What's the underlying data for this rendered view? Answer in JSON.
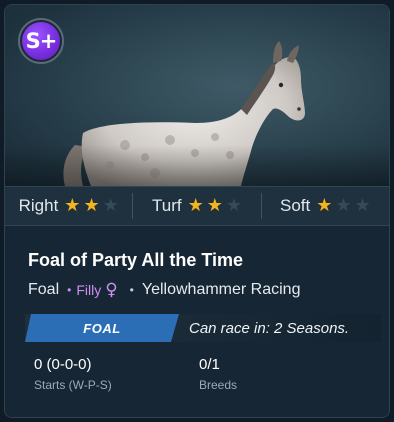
{
  "card": {
    "grade": "S+",
    "horse_image": "grey-dappled-foal-illustration",
    "accent_color": "#2b6eb5",
    "grade_color": "#7a2fe0",
    "star_color": "#f3b51d"
  },
  "ratings": [
    {
      "label": "Right",
      "stars": 2,
      "max": 3
    },
    {
      "label": "Turf",
      "stars": 2,
      "max": 3
    },
    {
      "label": "Soft",
      "stars": 1,
      "max": 3
    }
  ],
  "horse": {
    "name": "Foal of Party All the Time",
    "age_class": "Foal",
    "sex": "Filly",
    "sex_icon": "female-symbol-icon",
    "stable": "Yellowhammer Racing"
  },
  "status": {
    "badge": "FOAL",
    "race_text": "Can race in: 2 Seasons."
  },
  "stats": {
    "starts_value": "0 (0-0-0)",
    "starts_label": "Starts (W-P-S)",
    "breeds_value": "0/1",
    "breeds_label": "Breeds"
  }
}
